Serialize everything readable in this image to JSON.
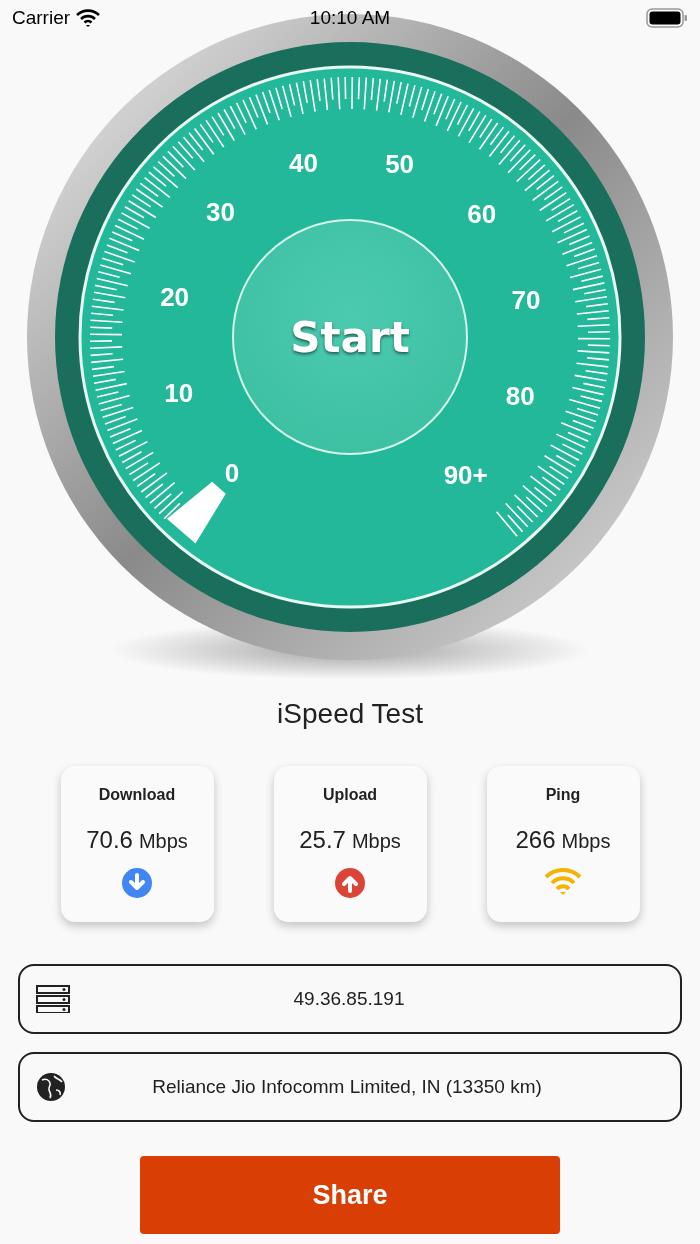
{
  "status_bar": {
    "carrier": "Carrier",
    "time": "10:10 AM"
  },
  "gauge": {
    "scale_labels": [
      "0",
      "10",
      "20",
      "30",
      "40",
      "50",
      "60",
      "70",
      "80",
      "90+"
    ],
    "start_button": "Start"
  },
  "title": "iSpeed Test",
  "stats": [
    {
      "kind": "download",
      "label": "Download",
      "value": "70.6",
      "unit": "Mbps"
    },
    {
      "kind": "upload",
      "label": "Upload",
      "value": "25.7",
      "unit": "Mbps"
    },
    {
      "kind": "ping",
      "label": "Ping",
      "value": "266",
      "unit": "Mbps"
    }
  ],
  "info_rows": [
    {
      "kind": "server",
      "text": "49.36.85.191"
    },
    {
      "kind": "globe",
      "text": "Reliance Jio Infocomm Limited, IN (13350 km)"
    }
  ],
  "share_button": "Share"
}
